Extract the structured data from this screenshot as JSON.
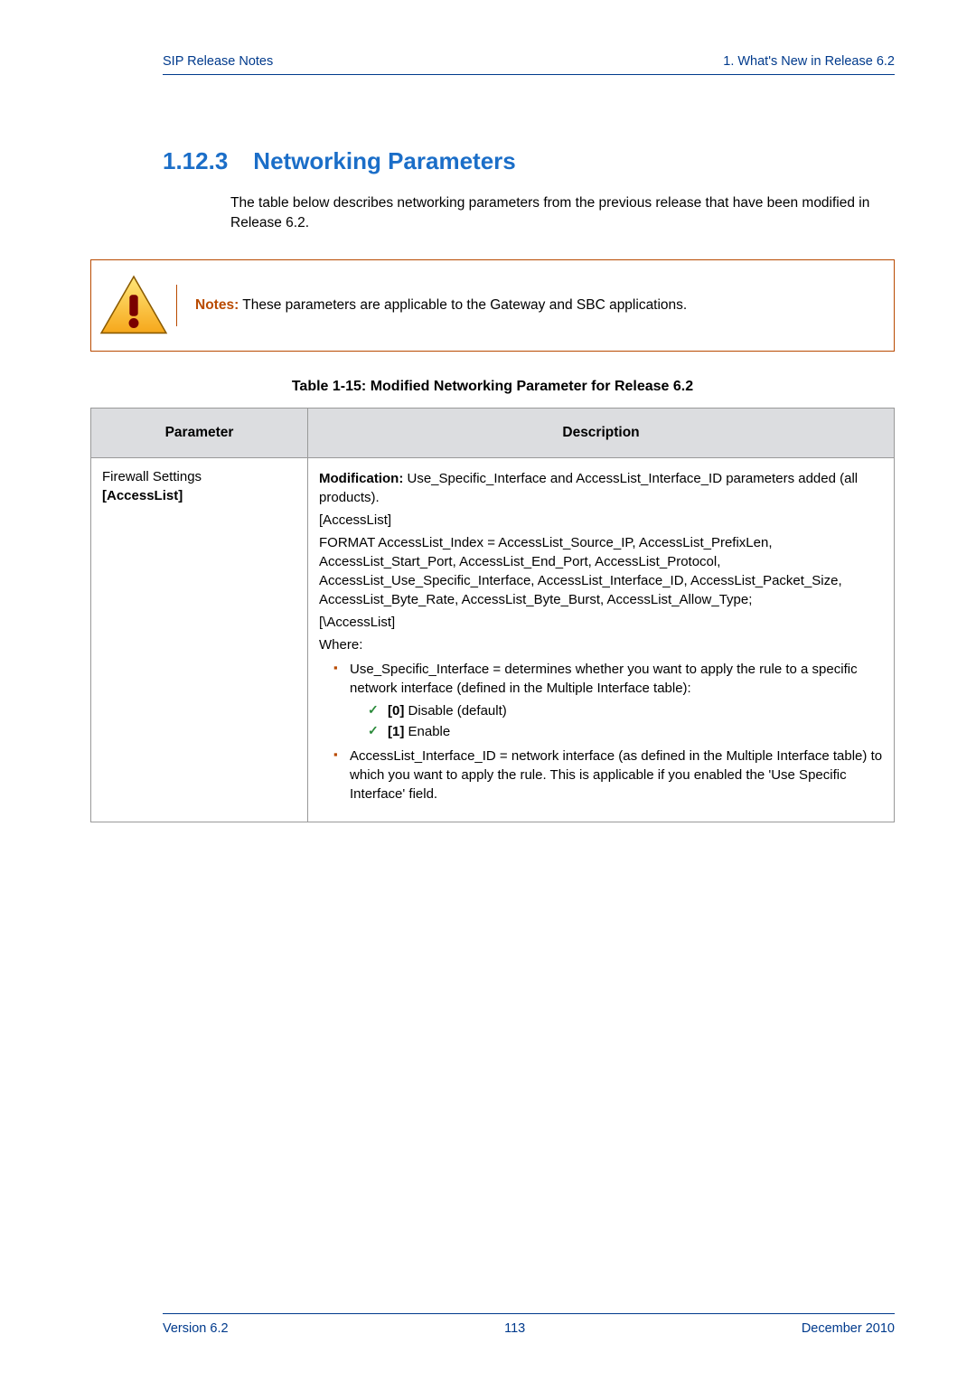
{
  "header": {
    "left": "SIP Release Notes",
    "right": "1. What's New in Release 6.2"
  },
  "section": {
    "number": "1.12.3",
    "title": "Networking Parameters",
    "intro": "The table below describes networking parameters from the previous release that have been modified in Release 6.2."
  },
  "note": {
    "label": "Notes:",
    "text": "  These parameters are applicable to the Gateway and SBC applications."
  },
  "table": {
    "caption": "Table 1-15: Modified Networking Parameter for Release 6.2",
    "head_param": "Parameter",
    "head_desc": "Description",
    "row": {
      "param_line1": "Firewall Settings",
      "param_line2": "[AccessList]",
      "mod_label": "Modification:",
      "mod_text": " Use_Specific_Interface and AccessList_Interface_ID parameters added (all products).",
      "line_accesslist": "[AccessList]",
      "line_format": "FORMAT AccessList_Index = AccessList_Source_IP, AccessList_PrefixLen, AccessList_Start_Port, AccessList_End_Port, AccessList_Protocol, AccessList_Use_Specific_Interface, AccessList_Interface_ID, AccessList_Packet_Size, AccessList_Byte_Rate, AccessList_Byte_Burst, AccessList_Allow_Type;",
      "line_backslash": "[\\AccessList]",
      "line_where": "Where:",
      "bullet1_text": "Use_Specific_Interface = determines whether you want to apply the rule to a specific network interface (defined in the Multiple Interface table):",
      "check1_label": "[0]",
      "check1_text": " Disable (default)",
      "check2_label": "[1]",
      "check2_text": " Enable",
      "bullet2_text": "AccessList_Interface_ID = network interface (as defined in the Multiple Interface table) to which you want to apply the rule. This is applicable if you enabled the 'Use Specific Interface' field."
    }
  },
  "footer": {
    "left": "Version 6.2",
    "center": "113",
    "right": "December 2010"
  }
}
